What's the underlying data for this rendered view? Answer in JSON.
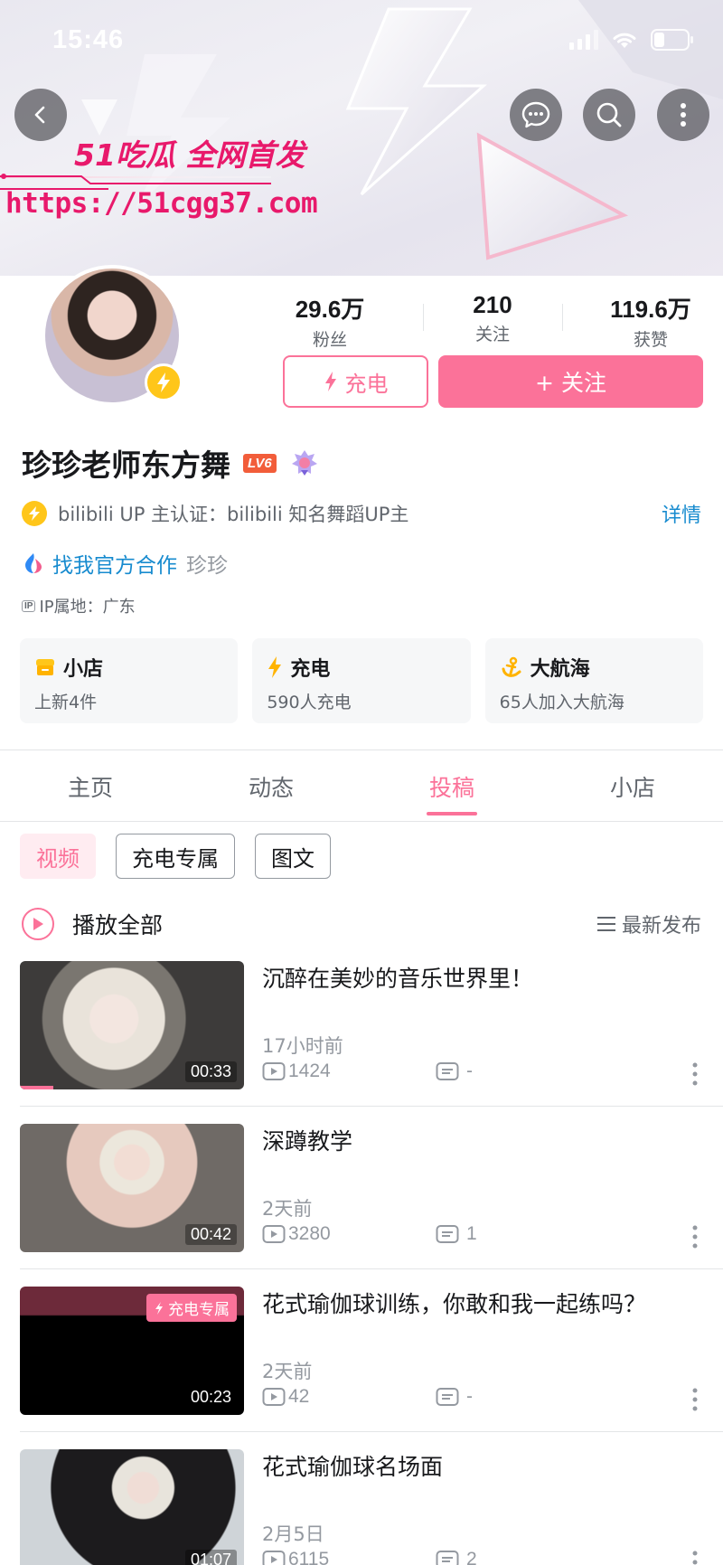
{
  "status_bar": {
    "time": "15:46"
  },
  "banner": {
    "ad_line1": "51吃瓜 全网首发",
    "ad_line2": "https://51cgg37.com"
  },
  "toolbar": {
    "back_icon": "chevron-left-icon",
    "message_icon": "message-bubble-icon",
    "search_icon": "search-icon",
    "more_icon": "more-vertical-icon"
  },
  "profile": {
    "stats": [
      {
        "value": "29.6万",
        "label": "粉丝"
      },
      {
        "value": "210",
        "label": "关注"
      },
      {
        "value": "119.6万",
        "label": "获赞"
      }
    ],
    "charge_label": "充电",
    "follow_label": "+ 关注",
    "name": "珍珍老师东方舞",
    "level": "LV6",
    "verify_text": "bilibili UP 主认证：bilibili 知名舞蹈UP主",
    "detail_label": "详情",
    "coop_link": "找我官方合作",
    "coop_name": "珍珍",
    "ip_tag": "IP",
    "ip_location": "IP属地：广东"
  },
  "cards": [
    {
      "title": "小店",
      "sub": "上新4件",
      "icon": "shop-icon"
    },
    {
      "title": "充电",
      "sub": "590人充电",
      "icon": "lightning-icon"
    },
    {
      "title": "大航海",
      "sub": "65人加入大航海",
      "icon": "anchor-icon"
    }
  ],
  "tabs": [
    {
      "label": "主页",
      "active": false
    },
    {
      "label": "动态",
      "active": false
    },
    {
      "label": "投稿",
      "active": true
    },
    {
      "label": "小店",
      "active": false
    }
  ],
  "filters": [
    {
      "label": "视频",
      "active": true
    },
    {
      "label": "充电专属",
      "active": false
    },
    {
      "label": "图文",
      "active": false
    }
  ],
  "play_all": {
    "label": "播放全部",
    "sort_label": "最新发布"
  },
  "videos": [
    {
      "title": "沉醉在美妙的音乐世界里！",
      "time": "17小时前",
      "views": "1424",
      "danmaku": "-",
      "duration": "00:33",
      "exclusive": "",
      "progress": 0.15
    },
    {
      "title": "深蹲教学",
      "time": "2天前",
      "views": "3280",
      "danmaku": "1",
      "duration": "00:42",
      "exclusive": "",
      "progress": 0
    },
    {
      "title": "花式瑜伽球训练，你敢和我一起练吗？",
      "time": "2天前",
      "views": "42",
      "danmaku": "-",
      "duration": "00:23",
      "exclusive": "充电专属",
      "progress": 0
    },
    {
      "title": "花式瑜伽球名场面",
      "time": "2月5日",
      "views": "6115",
      "danmaku": "2",
      "duration": "01:07",
      "exclusive": "",
      "progress": 0
    }
  ],
  "colors": {
    "accent": "#fb7299",
    "link": "#178bcf",
    "gold": "#ffc61a"
  }
}
